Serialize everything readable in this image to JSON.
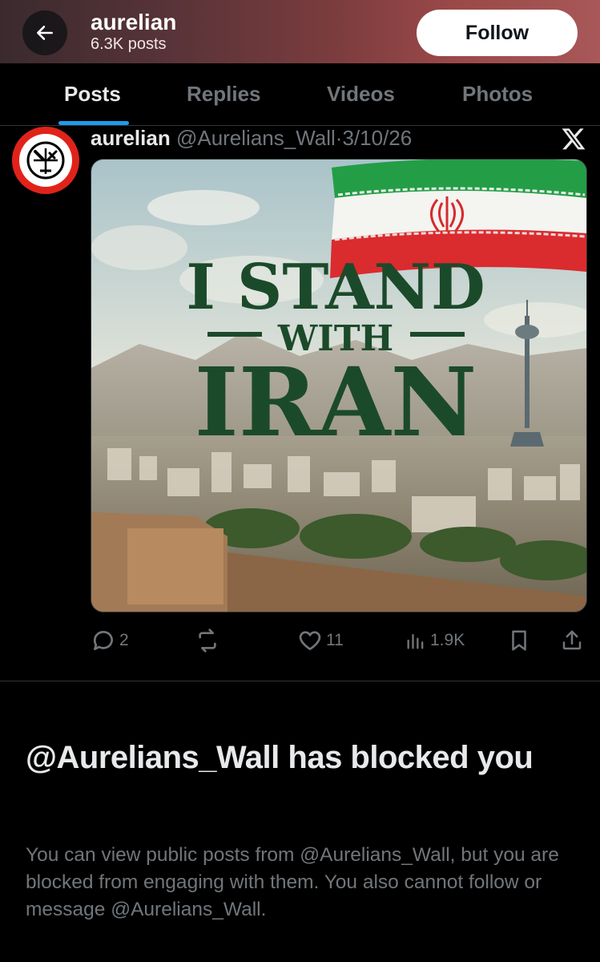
{
  "header": {
    "name": "aurelian",
    "post_count": "6.3K posts",
    "follow_label": "Follow"
  },
  "tabs": [
    {
      "label": "Posts",
      "active": true
    },
    {
      "label": "Replies",
      "active": false
    },
    {
      "label": "Videos",
      "active": false
    },
    {
      "label": "Photos",
      "active": false
    }
  ],
  "post": {
    "display_name": "aurelian",
    "handle": "@Aurelians_Wall",
    "separator": "·",
    "date": "3/10/26",
    "image": {
      "headline_line1": "I STAND",
      "headline_line2": "WITH",
      "headline_line3": "IRAN"
    },
    "actions": {
      "replies": "2",
      "reposts": "",
      "likes": "11",
      "views": "1.9K"
    }
  },
  "block_notice": {
    "title": "@Aurelians_Wall has blocked you",
    "description": "You can view public posts from @Aurelians_Wall, but you are blocked from engaging with them. You also cannot follow or message @Aurelians_Wall."
  },
  "colors": {
    "accent": "#1d9bf0",
    "muted": "#71767b",
    "background": "#000000",
    "header_gradient_end": "#a85858"
  },
  "icons": [
    "back-arrow-icon",
    "x-logo-icon",
    "reply-icon",
    "repost-icon",
    "like-icon",
    "views-icon",
    "bookmark-icon",
    "share-icon"
  ]
}
